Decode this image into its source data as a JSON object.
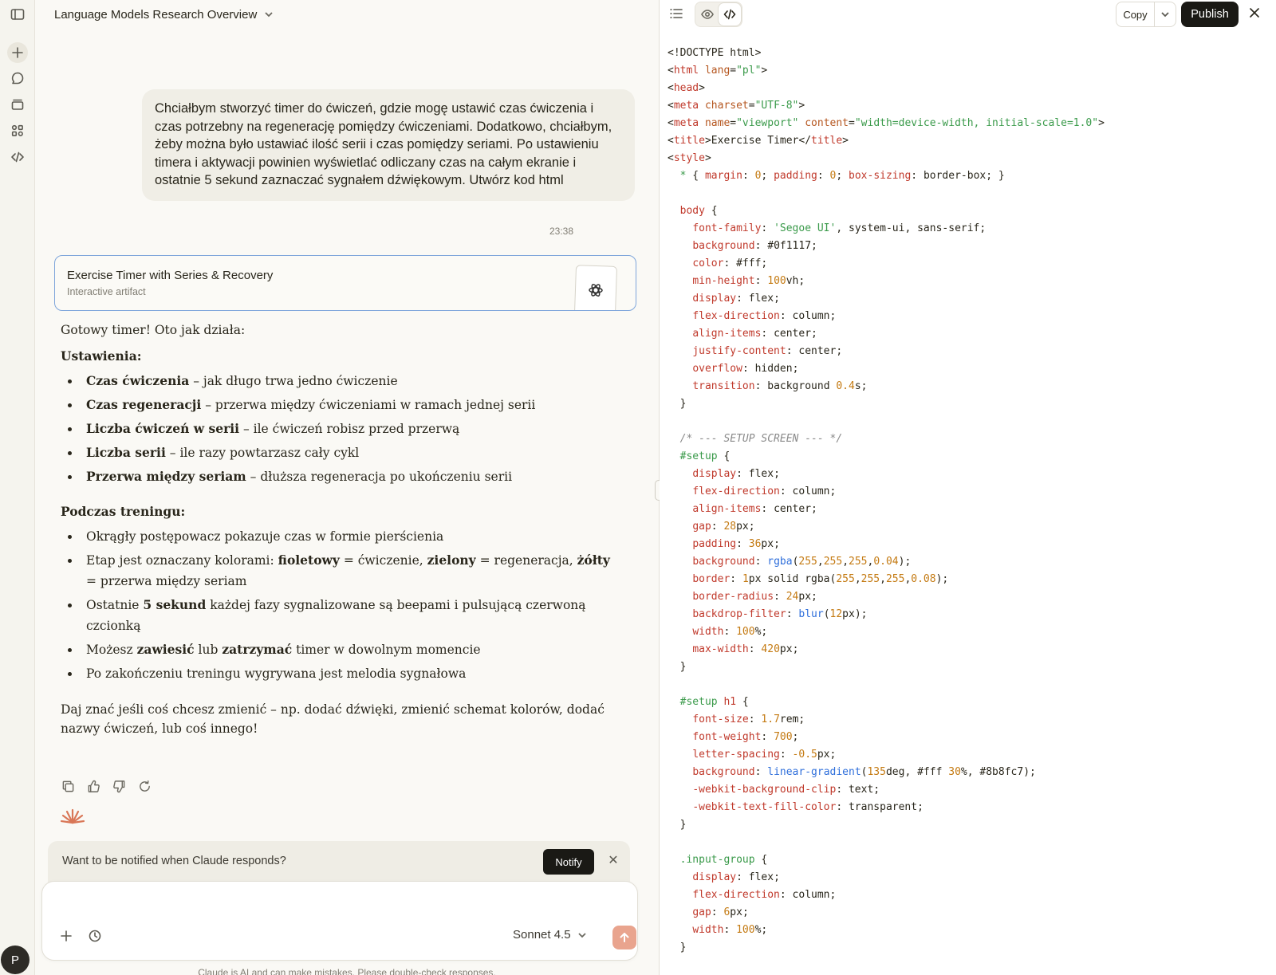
{
  "header": {
    "title": "Language Models Research Overview"
  },
  "user_message": {
    "text": "Chciałbym stworzyć timer do ćwiczeń, gdzie mogę ustawić czas ćwiczenia i czas potrzebny na regenerację pomiędzy ćwiczeniami. Dodatkowo, chciałbym, żeby można było ustawiać ilość serii i czas pomiędzy seriami. Po ustawieniu timera i aktywacji powinien wyświetlać odliczany czas na całym ekranie i ostatnie 5 sekund zaznaczać sygnałem dźwiękowym. Utwórz kod html",
    "time": "23:38"
  },
  "artifact": {
    "title": "Exercise Timer with Series & Recovery",
    "subtitle": "Interactive artifact"
  },
  "answer": {
    "intro": "Gotowy timer! Oto jak działa:",
    "settings_heading": "Ustawienia:",
    "settings": [
      {
        "term": "Czas ćwiczenia",
        "desc": " – jak długo trwa jedno ćwiczenie"
      },
      {
        "term": "Czas regeneracji",
        "desc": " – przerwa między ćwiczeniami w ramach jednej serii"
      },
      {
        "term": "Liczba ćwiczeń w serii",
        "desc": " – ile ćwiczeń robisz przed przerwą"
      },
      {
        "term": "Liczba serii",
        "desc": " – ile razy powtarzasz cały cykl"
      },
      {
        "term": "Przerwa między seriam",
        "desc": " – dłuższa regeneracja po ukończeniu serii"
      }
    ],
    "training_heading": "Podczas treningu:",
    "training": {
      "item1": "Okrągły postępowacz pokazuje czas w formie pierścienia",
      "item2_a": "Etap jest oznaczany kolorami: ",
      "item2_b": "fioletowy",
      "item2_c": " = ćwiczenie, ",
      "item2_d": "zielony",
      "item2_e": " = regeneracja, ",
      "item2_f": "żółty",
      "item2_g": " = przerwa między seriam",
      "item3_a": "Ostatnie ",
      "item3_b": "5 sekund",
      "item3_c": " każdej fazy sygnalizowane są beepami i pulsującą czerwoną czcionką",
      "item4_a": "Możesz ",
      "item4_b": "zawiesić",
      "item4_c": " lub ",
      "item4_d": "zatrzymać",
      "item4_e": " timer w dowolnym momencie",
      "item5": "Po zakończeniu treningu wygrywana jest melodia sygnałowa"
    },
    "outro": "Daj znać jeśli coś chcesz zmienić – np. dodać dźwięki, zmienić schemat kolorów, dodać nazwy ćwiczeń, lub coś innego!"
  },
  "notify": {
    "text": "Want to be notified when Claude responds?",
    "button": "Notify",
    "close": "✕"
  },
  "composer": {
    "placeholder": "",
    "model": "Sonnet 4.5"
  },
  "disclaimer": "Claude is AI and can make mistakes. Please double-check responses.",
  "user": {
    "initial": "P"
  },
  "panel": {
    "copy_label": "Copy",
    "publish_label": "Publish"
  },
  "code_lines": [
    "<!DOCTYPE html>",
    "<html lang=\"pl\">",
    "<head>",
    "<meta charset=\"UTF-8\">",
    "<meta name=\"viewport\" content=\"width=device-width, initial-scale=1.0\">",
    "<title>Exercise Timer</title>",
    "<style>",
    "  * { margin: 0; padding: 0; box-sizing: border-box; }",
    "",
    "  body {",
    "    font-family: 'Segoe UI', system-ui, sans-serif;",
    "    background: #0f1117;",
    "    color: #fff;",
    "    min-height: 100vh;",
    "    display: flex;",
    "    flex-direction: column;",
    "    align-items: center;",
    "    justify-content: center;",
    "    overflow: hidden;",
    "    transition: background 0.4s;",
    "  }",
    "",
    "  /* --- SETUP SCREEN --- */",
    "  #setup {",
    "    display: flex;",
    "    flex-direction: column;",
    "    align-items: center;",
    "    gap: 28px;",
    "    padding: 36px;",
    "    background: rgba(255,255,255,0.04);",
    "    border: 1px solid rgba(255,255,255,0.08);",
    "    border-radius: 24px;",
    "    backdrop-filter: blur(12px);",
    "    width: 100%;",
    "    max-width: 420px;",
    "  }",
    "",
    "  #setup h1 {",
    "    font-size: 1.7rem;",
    "    font-weight: 700;",
    "    letter-spacing: -0.5px;",
    "    background: linear-gradient(135deg, #fff 30%, #8b8fc7);",
    "    -webkit-background-clip: text;",
    "    -webkit-text-fill-color: transparent;",
    "  }",
    "",
    "  .input-group {",
    "    display: flex;",
    "    flex-direction: column;",
    "    gap: 6px;",
    "    width: 100%;",
    "  }"
  ]
}
